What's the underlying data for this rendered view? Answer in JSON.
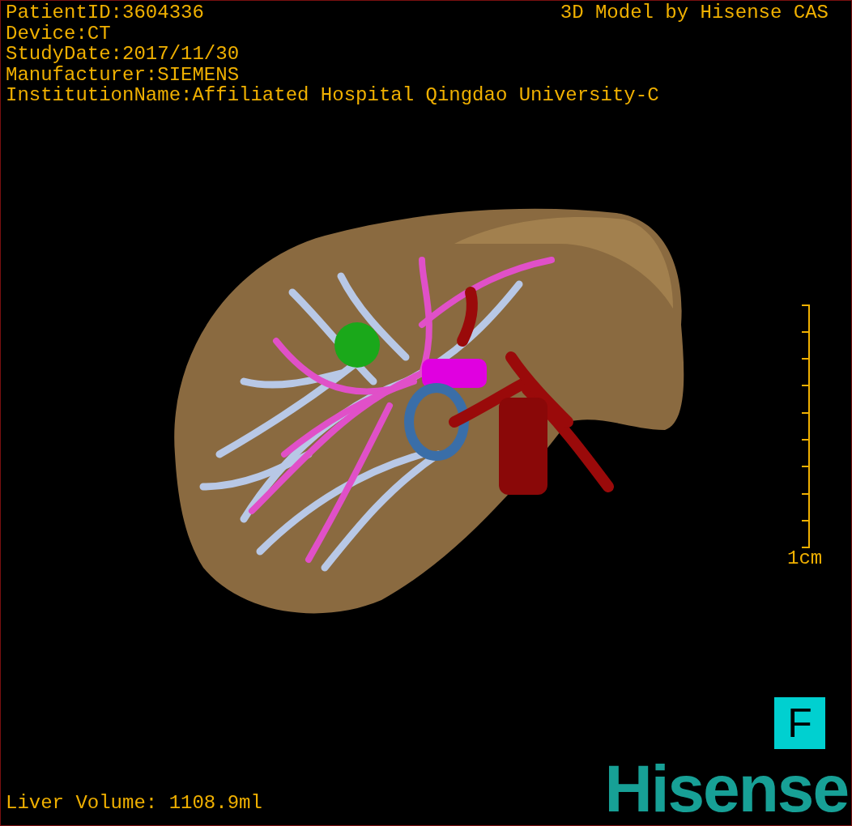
{
  "info_lines": [
    "PatientID:3604336",
    "Device:CT",
    "StudyDate:2017/11/30",
    "Manufacturer:SIEMENS",
    "InstitutionName:Affiliated Hospital Qingdao University-C"
  ],
  "credit": "3D Model by Hisense CAS",
  "scale_bar": {
    "label": "1cm"
  },
  "orientation_marker": "F",
  "liver_volume": "Liver Volume: 1108.9ml",
  "logo": "Hisense"
}
